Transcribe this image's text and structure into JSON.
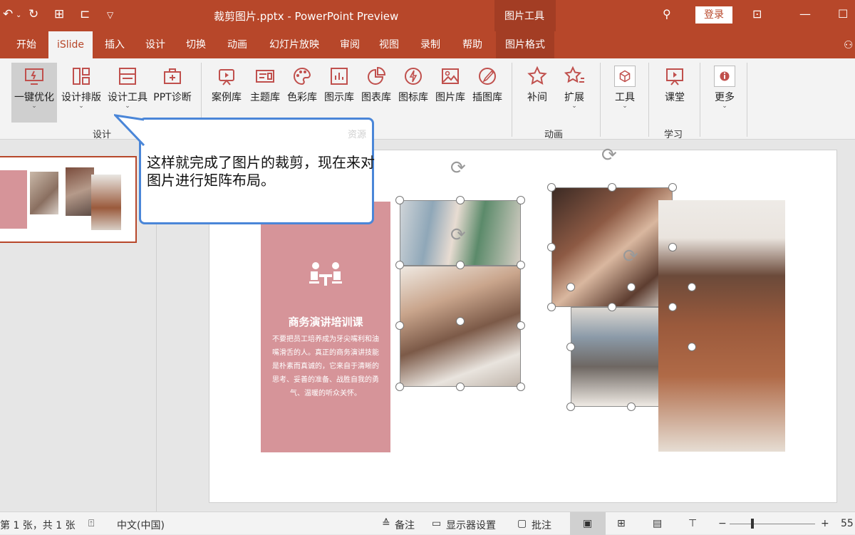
{
  "titlebar": {
    "doc_title": "裁剪图片.pptx - PowerPoint Preview",
    "context_group": "图片工具",
    "login": "登录",
    "accent": "#b7472a"
  },
  "tabs": [
    "开始",
    "iSlide",
    "插入",
    "设计",
    "切换",
    "动画",
    "幻灯片放映",
    "审阅",
    "视图",
    "录制",
    "帮助",
    "图片格式"
  ],
  "active_tab": "iSlide",
  "ribbon": {
    "design_buttons": [
      "一键优化",
      "设计排版",
      "设计工具",
      "PPT诊断"
    ],
    "library_buttons": [
      "案例库",
      "主题库",
      "色彩库",
      "图示库",
      "图表库",
      "图标库",
      "图片库",
      "插图库"
    ],
    "anim_buttons": [
      "补间",
      "扩展"
    ],
    "tools_button": "工具",
    "class_button": "课堂",
    "more_button": "更多",
    "group_labels": {
      "design": "设计",
      "resource": "资源",
      "animation": "动画",
      "learn": "学习"
    }
  },
  "callout": {
    "text": "这样就完成了图片的裁剪，现在来对图片进行矩阵布局。"
  },
  "slide": {
    "panel_title": "商务演讲培训课",
    "panel_body": "不要把员工培养成为牙尖嘴利和油嘴滑舌的人。真正的商务演讲技能是朴素而真诚的，它来自于清晰的思考、妥善的准备、战胜自我的勇气、温暖的听众关怀。",
    "panel_color": "#d69499"
  },
  "statusbar": {
    "slide_count": "第 1 张，共 1 张",
    "language": "中文(中国)",
    "notes": "备注",
    "display": "显示器设置",
    "comments": "批注",
    "zoom": "55"
  }
}
